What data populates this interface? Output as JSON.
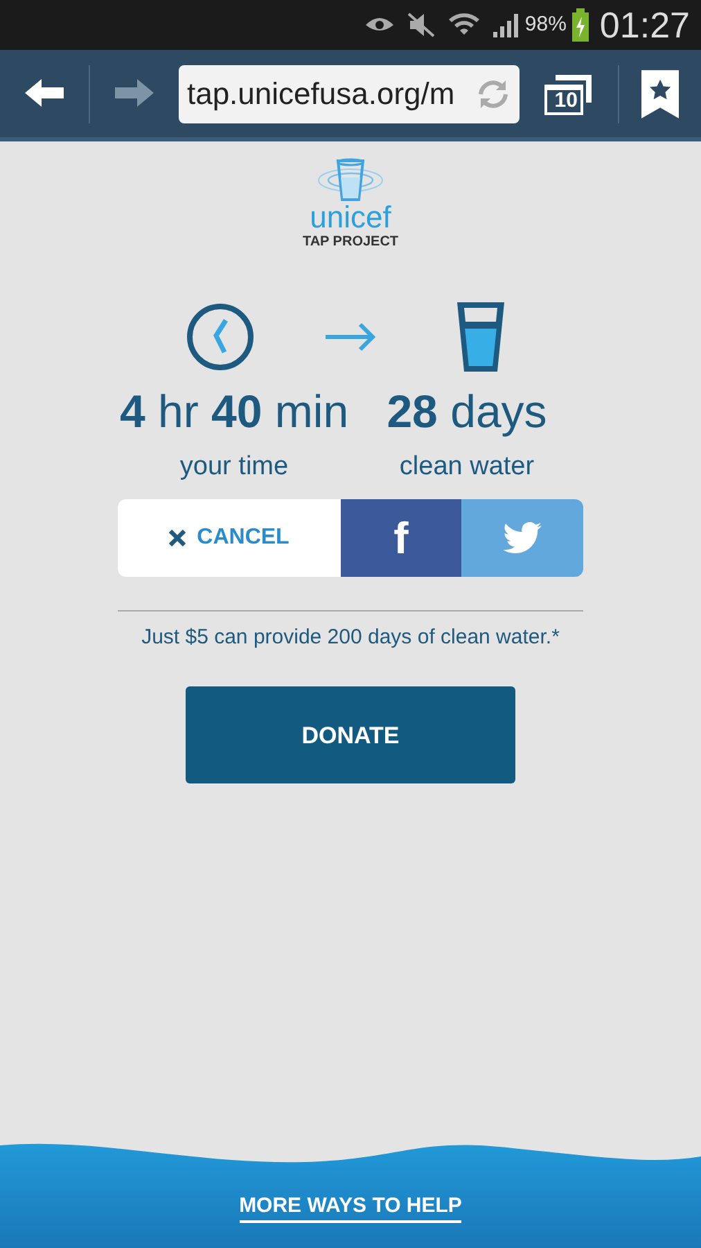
{
  "status_bar": {
    "battery": "98%",
    "time": "01:27"
  },
  "browser": {
    "nav": [
      {
        "kind": "back",
        "disabled": false
      },
      {
        "kind": "forward",
        "disabled": true
      }
    ],
    "url": "tap.unicefusa.org/m",
    "tab_count": "10"
  },
  "logo": {
    "name": "unicef",
    "subtitle": "TAP PROJECT"
  },
  "stats": [
    {
      "value": "**4** hr **40** min",
      "caption": "your time"
    },
    {
      "value": "**28** days",
      "caption": "clean water"
    }
  ],
  "actions": [
    {
      "kind": "cancel",
      "label": "CANCEL"
    },
    {
      "kind": "facebook",
      "label": "f"
    },
    {
      "kind": "twitter"
    }
  ],
  "note": "Just $5 can provide 200 days of clean water.*",
  "donate": "DONATE",
  "footer_link": "MORE WAYS TO HELP"
}
